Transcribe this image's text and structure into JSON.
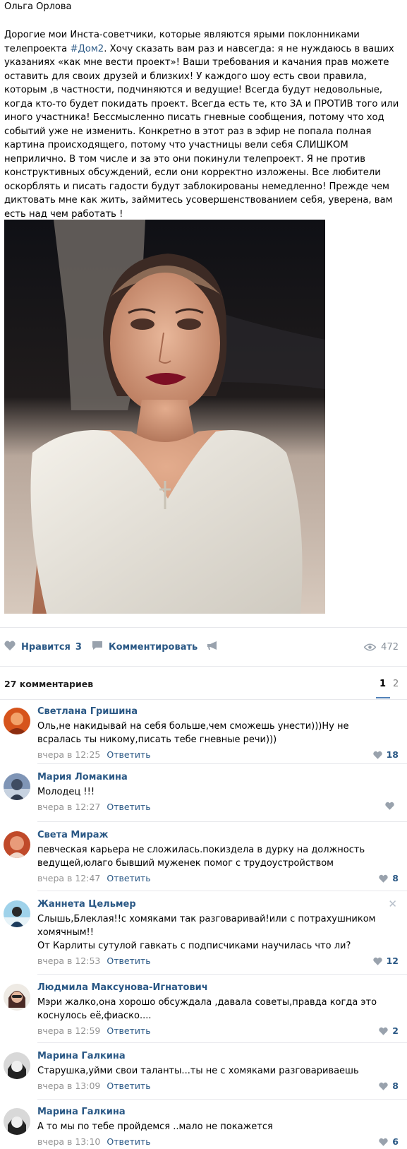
{
  "post": {
    "author": "Ольга Орлова",
    "text_part1": "Дорогие мои Инста-советчики, которые являются ярыми поклонниками телепроекта ",
    "hashtag": "#Дом2",
    "text_part2": ". Хочу сказать вам раз и навсегда: я не нуждаюсь в ваших указаниях «как мне вести проект»! Ваши требования и качания прав можете оставить для своих друзей и близких! У каждого шоу есть свои правила, которым ,в частности, подчиняются и ведущие! Всегда будут недовольные, когда кто-то будет покидать проект. Всегда есть те, кто ЗА и ПРОТИВ того или иного участника! Бессмысленно писать гневные сообщения, потому что ход событий уже не изменить. Конкретно в этот раз в эфир не попала полная картина происходящего, потому что участницы вели себя СЛИШКОМ неприлично. В том числе и за это они покинули телепроект. Я не против конструктивных обсуждений, если они корректно изложены. Все любители оскорблять и писать гадости будут заблокированы немедленно! Прежде чем диктовать мне как жить, займитесь усовершенствованием себя, уверена, вам есть над чем работать !"
  },
  "actions": {
    "like_label": "Нравится",
    "like_count": "3",
    "comment_label": "Комментировать",
    "views": "472"
  },
  "comments_header": {
    "title": "27 комментариев",
    "pages": [
      "1",
      "2"
    ]
  },
  "comments": [
    {
      "author": "Светлана Гришина",
      "text": "Оль,не накидывай на себя больше,чем сможешь унести)))Ну не всралась ты никому,писать тебе гневные речи)))",
      "time": "вчера в 12:25",
      "reply": "Ответить",
      "likes": "18"
    },
    {
      "author": "Мария Ломакина",
      "text": "Молодец !!!",
      "time": "вчера в 12:27",
      "reply": "Ответить",
      "likes": ""
    },
    {
      "author": "Света Мираж",
      "text": "певческая карьера не сложилась.покиздела в дурку на должность ведущей,юлаго бывший муженек помог с трудоустройством",
      "time": "вчера в 12:47",
      "reply": "Ответить",
      "likes": "8"
    },
    {
      "author": "Жаннета Цельмер",
      "text": "Слышь,Блеклая!!с хомяками так разговаривай!или с потрахушником хомячным!!\nОт Карлиты сутулой гавкать с подписчиками научилась что ли?",
      "time": "вчера в 12:53",
      "reply": "Ответить",
      "likes": "12"
    },
    {
      "author": "Людмила Максунова-Игнатович",
      "text": "Мэри жалко,она хорошо обсуждала ,давала советы,правда когда это коснулось её,фиаско....",
      "time": "вчера в 12:59",
      "reply": "Ответить",
      "likes": "2"
    },
    {
      "author": "Марина Галкина",
      "text": "Старушка,уйми свои таланты...ты не с хомяками разговариваешь",
      "time": "вчера в 13:09",
      "reply": "Ответить",
      "likes": "8"
    },
    {
      "author": "Марина Галкина",
      "text": "А то мы по тебе пройдемся ..мало не покажется",
      "time": "вчера в 13:10",
      "reply": "Ответить",
      "likes": "6"
    }
  ],
  "colors": {
    "link": "#2a5885",
    "meta": "#939393",
    "separator": "#e7e8ec"
  },
  "icons": {
    "like": "heart-icon",
    "comment": "speech-bubble-icon",
    "share": "megaphone-icon",
    "views": "eye-icon",
    "remove": "close-icon"
  }
}
